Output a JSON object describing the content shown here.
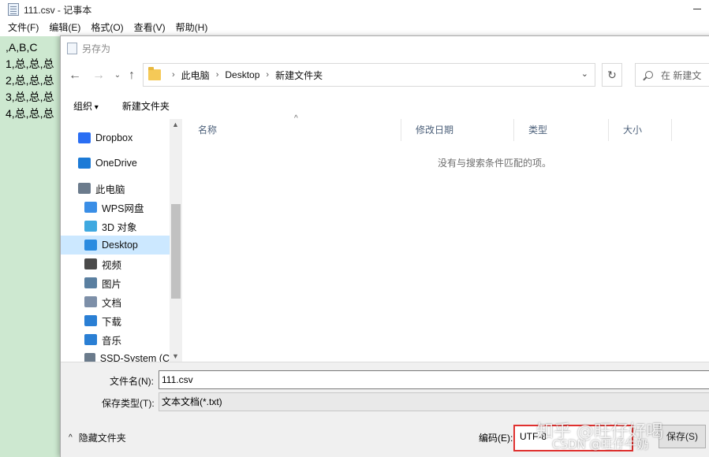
{
  "notepad": {
    "title": "111.csv - 记事本",
    "menu": [
      "文件(F)",
      "编辑(E)",
      "格式(O)",
      "查看(V)",
      "帮助(H)"
    ],
    "content": ",A,B,C\n1,总,总,总\n2,总,总,总\n3,总,总,总\n4,总,总,总"
  },
  "dialog": {
    "title": "另存为",
    "address": {
      "crumbs": [
        "此电脑",
        "Desktop",
        "新建文件夹"
      ]
    },
    "search_placeholder": "在 新建文",
    "toolbar": {
      "organize": "组织",
      "new_folder": "新建文件夹"
    },
    "nav_items": [
      {
        "label": "Dropbox",
        "icon": "dropbox-icon",
        "color": "#2a6ef3"
      },
      {
        "label": "OneDrive",
        "icon": "onedrive-icon",
        "color": "#1c7ad6"
      },
      {
        "label": "此电脑",
        "icon": "computer-icon",
        "color": "#6b7b8c"
      },
      {
        "label": "WPS网盘",
        "icon": "wps-cloud-icon",
        "color": "#3a8ee6"
      },
      {
        "label": "3D 对象",
        "icon": "3d-objects-icon",
        "color": "#3fa9e0"
      },
      {
        "label": "Desktop",
        "icon": "desktop-icon",
        "color": "#2a8be0",
        "selected": true
      },
      {
        "label": "视频",
        "icon": "video-icon",
        "color": "#4a4a4a"
      },
      {
        "label": "图片",
        "icon": "pictures-icon",
        "color": "#5a7fa0"
      },
      {
        "label": "文档",
        "icon": "documents-icon",
        "color": "#7d8fa8"
      },
      {
        "label": "下载",
        "icon": "download-icon",
        "color": "#2a7fd4"
      },
      {
        "label": "音乐",
        "icon": "music-icon",
        "color": "#2a7fd4"
      },
      {
        "label": "SSD-System (C",
        "icon": "drive-icon",
        "color": "#6b7b8c"
      }
    ],
    "columns": [
      "名称",
      "修改日期",
      "类型",
      "大小"
    ],
    "empty_message": "没有与搜索条件匹配的项。",
    "filename_label": "文件名(N):",
    "filename_value": "111.csv",
    "filetype_label": "保存类型(T):",
    "filetype_value": "文本文档(*.txt)",
    "hide_folders": "隐藏文件夹",
    "encoding_label": "编码(E):",
    "encoding_value": "UTF-8",
    "save_label": "保存(S)"
  },
  "watermark": {
    "line1": "知乎 @旺仔好喝",
    "line2": "CSDN @旺仔牛奶"
  }
}
